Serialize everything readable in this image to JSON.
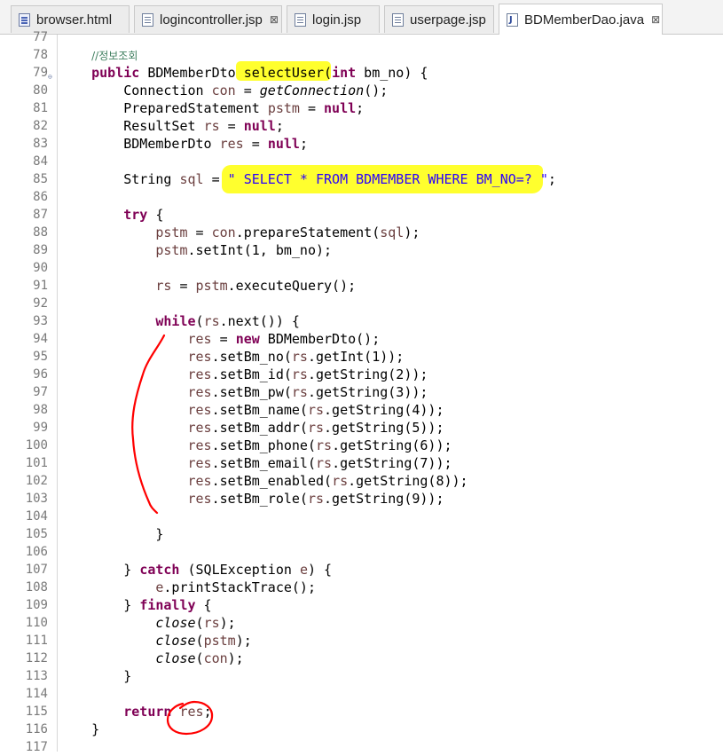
{
  "tabs": [
    {
      "label": "browser.html",
      "icon": "html-file-icon",
      "active": false,
      "close": ""
    },
    {
      "label": "logincontroller.jsp",
      "icon": "jsp-file-icon",
      "active": false,
      "close": "⊠"
    },
    {
      "label": "login.jsp",
      "icon": "jsp-file-icon",
      "active": false,
      "close": ""
    },
    {
      "label": "userpage.jsp",
      "icon": "jsp-file-icon",
      "active": false,
      "close": ""
    },
    {
      "label": "BDMemberDao.java",
      "icon": "java-file-icon",
      "active": true,
      "close": "⊠"
    }
  ],
  "editor": {
    "lines": [
      {
        "n": "77",
        "fold": "",
        "tokens": []
      },
      {
        "n": "78",
        "fold": "",
        "tokens": [
          {
            "t": "    "
          },
          {
            "t": "//정보조회",
            "c": "cm"
          }
        ]
      },
      {
        "n": "79",
        "fold": "⊖",
        "tokens": [
          {
            "t": "    "
          },
          {
            "t": "public",
            "c": "kw"
          },
          {
            "t": " BDMemberDto "
          },
          {
            "t": "selectUser"
          },
          {
            "t": "("
          },
          {
            "t": "int",
            "c": "kw"
          },
          {
            "t": " bm_no) {"
          }
        ]
      },
      {
        "n": "80",
        "fold": "",
        "tokens": [
          {
            "t": "        Connection "
          },
          {
            "t": "con",
            "c": "var"
          },
          {
            "t": " = "
          },
          {
            "t": "getConnection",
            "c": "it"
          },
          {
            "t": "();"
          }
        ]
      },
      {
        "n": "81",
        "fold": "",
        "tokens": [
          {
            "t": "        PreparedStatement "
          },
          {
            "t": "pstm",
            "c": "var"
          },
          {
            "t": " = "
          },
          {
            "t": "null",
            "c": "kw"
          },
          {
            "t": ";"
          }
        ]
      },
      {
        "n": "82",
        "fold": "",
        "tokens": [
          {
            "t": "        ResultSet "
          },
          {
            "t": "rs",
            "c": "var"
          },
          {
            "t": " = "
          },
          {
            "t": "null",
            "c": "kw"
          },
          {
            "t": ";"
          }
        ]
      },
      {
        "n": "83",
        "fold": "",
        "tokens": [
          {
            "t": "        BDMemberDto "
          },
          {
            "t": "res",
            "c": "var"
          },
          {
            "t": " = "
          },
          {
            "t": "null",
            "c": "kw"
          },
          {
            "t": ";"
          }
        ]
      },
      {
        "n": "84",
        "fold": "",
        "tokens": []
      },
      {
        "n": "85",
        "fold": "",
        "tokens": [
          {
            "t": "        String "
          },
          {
            "t": "sql",
            "c": "var"
          },
          {
            "t": " = "
          },
          {
            "t": "\" SELECT * FROM BDMEMBER WHERE BM_NO=? \"",
            "c": "str"
          },
          {
            "t": ";"
          }
        ]
      },
      {
        "n": "86",
        "fold": "",
        "tokens": []
      },
      {
        "n": "87",
        "fold": "",
        "tokens": [
          {
            "t": "        "
          },
          {
            "t": "try",
            "c": "kw"
          },
          {
            "t": " {"
          }
        ]
      },
      {
        "n": "88",
        "fold": "",
        "tokens": [
          {
            "t": "            "
          },
          {
            "t": "pstm",
            "c": "var"
          },
          {
            "t": " = "
          },
          {
            "t": "con",
            "c": "var"
          },
          {
            "t": ".prepareStatement("
          },
          {
            "t": "sql",
            "c": "var"
          },
          {
            "t": ");"
          }
        ]
      },
      {
        "n": "89",
        "fold": "",
        "tokens": [
          {
            "t": "            "
          },
          {
            "t": "pstm",
            "c": "var"
          },
          {
            "t": ".setInt(1, bm_no);"
          }
        ]
      },
      {
        "n": "90",
        "fold": "",
        "tokens": []
      },
      {
        "n": "91",
        "fold": "",
        "tokens": [
          {
            "t": "            "
          },
          {
            "t": "rs",
            "c": "var"
          },
          {
            "t": " = "
          },
          {
            "t": "pstm",
            "c": "var"
          },
          {
            "t": ".executeQuery();"
          }
        ]
      },
      {
        "n": "92",
        "fold": "",
        "tokens": []
      },
      {
        "n": "93",
        "fold": "",
        "tokens": [
          {
            "t": "            "
          },
          {
            "t": "while",
            "c": "kw"
          },
          {
            "t": "("
          },
          {
            "t": "rs",
            "c": "var"
          },
          {
            "t": ".next()) {"
          }
        ]
      },
      {
        "n": "94",
        "fold": "",
        "tokens": [
          {
            "t": "                "
          },
          {
            "t": "res",
            "c": "var"
          },
          {
            "t": " = "
          },
          {
            "t": "new",
            "c": "kw"
          },
          {
            "t": " BDMemberDto();"
          }
        ]
      },
      {
        "n": "95",
        "fold": "",
        "tokens": [
          {
            "t": "                "
          },
          {
            "t": "res",
            "c": "var"
          },
          {
            "t": ".setBm_no("
          },
          {
            "t": "rs",
            "c": "var"
          },
          {
            "t": ".getInt(1));"
          }
        ]
      },
      {
        "n": "96",
        "fold": "",
        "tokens": [
          {
            "t": "                "
          },
          {
            "t": "res",
            "c": "var"
          },
          {
            "t": ".setBm_id("
          },
          {
            "t": "rs",
            "c": "var"
          },
          {
            "t": ".getString(2));"
          }
        ]
      },
      {
        "n": "97",
        "fold": "",
        "tokens": [
          {
            "t": "                "
          },
          {
            "t": "res",
            "c": "var"
          },
          {
            "t": ".setBm_pw("
          },
          {
            "t": "rs",
            "c": "var"
          },
          {
            "t": ".getString(3));"
          }
        ]
      },
      {
        "n": "98",
        "fold": "",
        "tokens": [
          {
            "t": "                "
          },
          {
            "t": "res",
            "c": "var"
          },
          {
            "t": ".setBm_name("
          },
          {
            "t": "rs",
            "c": "var"
          },
          {
            "t": ".getString(4));"
          }
        ]
      },
      {
        "n": "99",
        "fold": "",
        "tokens": [
          {
            "t": "                "
          },
          {
            "t": "res",
            "c": "var"
          },
          {
            "t": ".setBm_addr("
          },
          {
            "t": "rs",
            "c": "var"
          },
          {
            "t": ".getString(5));"
          }
        ]
      },
      {
        "n": "100",
        "fold": "",
        "tokens": [
          {
            "t": "                "
          },
          {
            "t": "res",
            "c": "var"
          },
          {
            "t": ".setBm_phone("
          },
          {
            "t": "rs",
            "c": "var"
          },
          {
            "t": ".getString(6));"
          }
        ]
      },
      {
        "n": "101",
        "fold": "",
        "tokens": [
          {
            "t": "                "
          },
          {
            "t": "res",
            "c": "var"
          },
          {
            "t": ".setBm_email("
          },
          {
            "t": "rs",
            "c": "var"
          },
          {
            "t": ".getString(7));"
          }
        ]
      },
      {
        "n": "102",
        "fold": "",
        "tokens": [
          {
            "t": "                "
          },
          {
            "t": "res",
            "c": "var"
          },
          {
            "t": ".setBm_enabled("
          },
          {
            "t": "rs",
            "c": "var"
          },
          {
            "t": ".getString(8));"
          }
        ]
      },
      {
        "n": "103",
        "fold": "",
        "tokens": [
          {
            "t": "                "
          },
          {
            "t": "res",
            "c": "var"
          },
          {
            "t": ".setBm_role("
          },
          {
            "t": "rs",
            "c": "var"
          },
          {
            "t": ".getString(9));"
          }
        ]
      },
      {
        "n": "104",
        "fold": "",
        "tokens": []
      },
      {
        "n": "105",
        "fold": "",
        "tokens": [
          {
            "t": "            }"
          }
        ]
      },
      {
        "n": "106",
        "fold": "",
        "tokens": []
      },
      {
        "n": "107",
        "fold": "",
        "tokens": [
          {
            "t": "        } "
          },
          {
            "t": "catch",
            "c": "kw"
          },
          {
            "t": " (SQLException "
          },
          {
            "t": "e",
            "c": "var"
          },
          {
            "t": ") {"
          }
        ]
      },
      {
        "n": "108",
        "fold": "",
        "tokens": [
          {
            "t": "            "
          },
          {
            "t": "e",
            "c": "var"
          },
          {
            "t": ".printStackTrace();"
          }
        ]
      },
      {
        "n": "109",
        "fold": "",
        "tokens": [
          {
            "t": "        } "
          },
          {
            "t": "finally",
            "c": "kw"
          },
          {
            "t": " {"
          }
        ]
      },
      {
        "n": "110",
        "fold": "",
        "tokens": [
          {
            "t": "            "
          },
          {
            "t": "close",
            "c": "it"
          },
          {
            "t": "("
          },
          {
            "t": "rs",
            "c": "var"
          },
          {
            "t": ");"
          }
        ]
      },
      {
        "n": "111",
        "fold": "",
        "tokens": [
          {
            "t": "            "
          },
          {
            "t": "close",
            "c": "it"
          },
          {
            "t": "("
          },
          {
            "t": "pstm",
            "c": "var"
          },
          {
            "t": ");"
          }
        ]
      },
      {
        "n": "112",
        "fold": "",
        "tokens": [
          {
            "t": "            "
          },
          {
            "t": "close",
            "c": "it"
          },
          {
            "t": "("
          },
          {
            "t": "con",
            "c": "var"
          },
          {
            "t": ");"
          }
        ]
      },
      {
        "n": "113",
        "fold": "",
        "tokens": [
          {
            "t": "        }"
          }
        ]
      },
      {
        "n": "114",
        "fold": "",
        "tokens": []
      },
      {
        "n": "115",
        "fold": "",
        "tokens": [
          {
            "t": "        "
          },
          {
            "t": "return",
            "c": "kw"
          },
          {
            "t": " "
          },
          {
            "t": "res",
            "c": "var"
          },
          {
            "t": ";"
          }
        ]
      },
      {
        "n": "116",
        "fold": "",
        "tokens": [
          {
            "t": "    }"
          }
        ]
      },
      {
        "n": "117",
        "fold": "",
        "tokens": []
      }
    ]
  },
  "colors": {
    "keyword": "#7f0055",
    "string": "#2a00ff",
    "comment": "#3f7f5f",
    "local_var": "#6a3e3e",
    "highlight": "#ffff2e",
    "annotation": "#ff0000"
  }
}
